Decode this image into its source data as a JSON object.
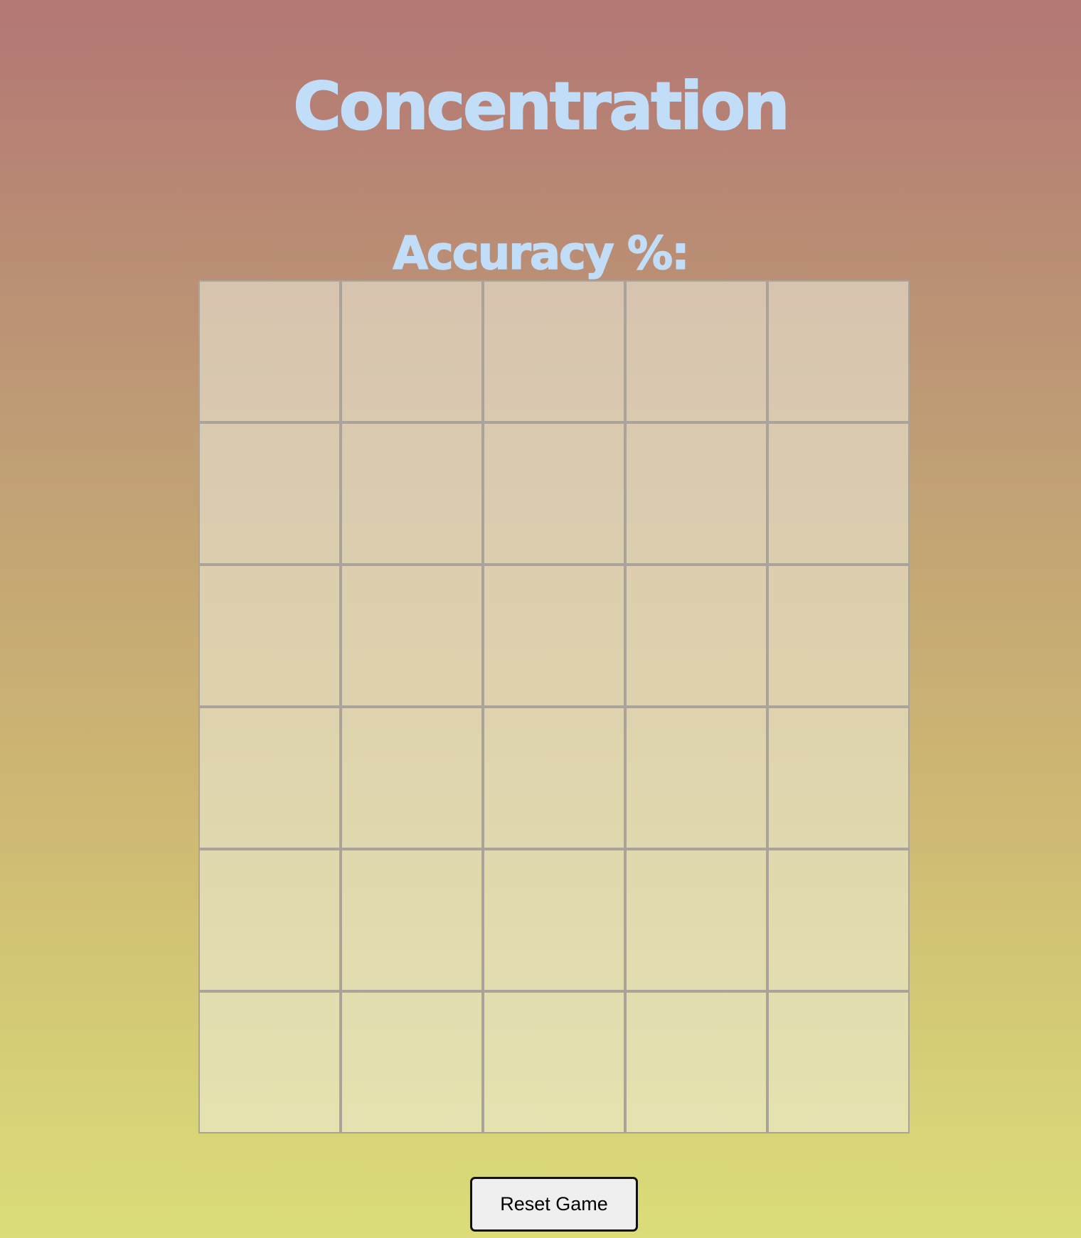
{
  "game": {
    "title": "Concentration",
    "accuracy_label": "Accuracy %:",
    "accuracy_value": ""
  },
  "board": {
    "rows": 6,
    "columns": 5,
    "cards": [
      {
        "face": "hidden"
      },
      {
        "face": "hidden"
      },
      {
        "face": "hidden"
      },
      {
        "face": "hidden"
      },
      {
        "face": "hidden"
      },
      {
        "face": "hidden"
      },
      {
        "face": "hidden"
      },
      {
        "face": "hidden"
      },
      {
        "face": "hidden"
      },
      {
        "face": "hidden"
      },
      {
        "face": "hidden"
      },
      {
        "face": "hidden"
      },
      {
        "face": "hidden"
      },
      {
        "face": "hidden"
      },
      {
        "face": "hidden"
      },
      {
        "face": "hidden"
      },
      {
        "face": "hidden"
      },
      {
        "face": "hidden"
      },
      {
        "face": "hidden"
      },
      {
        "face": "hidden"
      },
      {
        "face": "hidden"
      },
      {
        "face": "hidden"
      },
      {
        "face": "hidden"
      },
      {
        "face": "hidden"
      },
      {
        "face": "hidden"
      },
      {
        "face": "hidden"
      },
      {
        "face": "hidden"
      },
      {
        "face": "hidden"
      },
      {
        "face": "hidden"
      },
      {
        "face": "hidden"
      }
    ]
  },
  "controls": {
    "reset_label": "Reset Game"
  },
  "colors": {
    "heading": "#c2ddf7",
    "gradient_top": "#b37774",
    "gradient_bottom": "#dbdd79",
    "card_border": "#a9a399"
  }
}
